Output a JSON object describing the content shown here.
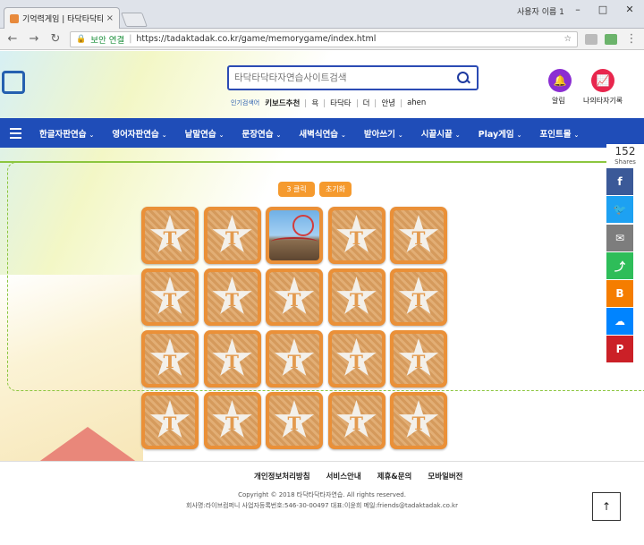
{
  "browser": {
    "tab_title": "기억력게임 | 타닥타닥타",
    "tab_close": "×",
    "window_user": "사용자 이름 1",
    "url_secure": "보안 연결",
    "url": "https://tadaktadak.co.kr/game/memorygame/index.html"
  },
  "header": {
    "search_placeholder": "타닥타닥타자연습사이트검색",
    "popular_label": "인기검색어",
    "keywords": [
      "키보드추천",
      "욕",
      "타닥타",
      "더",
      "안녕",
      "ahen"
    ],
    "alarm_label": "알림",
    "record_label": "나의타자기록"
  },
  "menu": [
    "한글자판연습",
    "영어자판연습",
    "낱말연습",
    "문장연습",
    "새벽식연습",
    "받아쓰기",
    "시끝시끝",
    "Play게임",
    "포인트몰"
  ],
  "game": {
    "clicks_label": "3 클릭",
    "reset_label": "초기화",
    "card_letter": "T",
    "rows": 4,
    "cols": 5,
    "revealed_index": 2
  },
  "share": {
    "count": "152",
    "label": "Shares",
    "colors": {
      "facebook": "#3b5998",
      "twitter": "#1da1f2",
      "email": "#7d7d7d",
      "sharethis": "#2ebd59",
      "blogger": "#f57d00",
      "messenger": "#0084ff",
      "pinterest": "#cb2027"
    }
  },
  "footer": {
    "links": [
      "개인정보처리방침",
      "서비스안내",
      "제휴&문의",
      "모바일버전"
    ],
    "copyright": "Copyright © 2018 타닥타닥타자연습. All rights reserved.",
    "company": "회사명:라이브컴퍼니 사업자등록번호:546-30-00497 대표:이윤희 메일:friends@tadaktadak.co.kr"
  },
  "colors": {
    "menu_bg": "#1f4db8",
    "accent_orange": "#f59a2e",
    "alarm": "#8b2ed2",
    "record": "#e8264d"
  }
}
